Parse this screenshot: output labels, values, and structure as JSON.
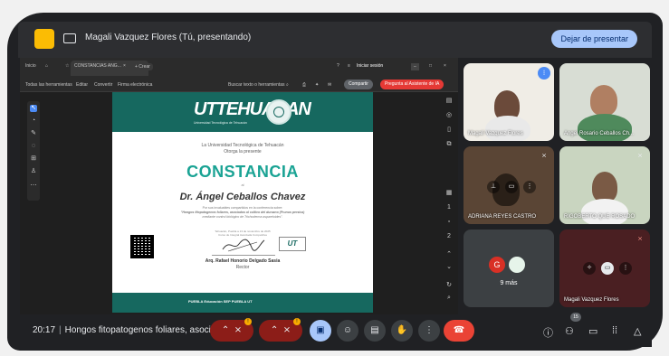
{
  "presenting": {
    "title": "Magali Vazquez Flores (Tú, presentando)",
    "stop_label": "Dejar de presentar"
  },
  "browser": {
    "tab_home": "Inicio",
    "tab_active": "CONSTANCIAS ANG...",
    "tab_new": "+ Crear",
    "sign_in": "Iniciar sesión",
    "menu": [
      "Todas las herramientas",
      "Editar",
      "Convertir",
      "Firma electrónica"
    ],
    "search_tools": "Buscar texto o herramientas",
    "share_label": "Compartir",
    "ai_label": "Pregunta al Asistente de IA"
  },
  "certificate": {
    "logo_text": "UTTEHUACAN",
    "logo_sub": "Universidad Tecnológica de Tehuacán",
    "university": "La Universidad Tecnológica de Tehuacán",
    "grants": "Otorga la presente",
    "heading": "CONSTANCIA",
    "to": "al",
    "recipient": "Dr. Ángel Ceballos Chavez",
    "desc1": "Por sus invaluables compartidos en la conferencia sobre:",
    "desc2": "\"Hongos fitopatogenos foliares, asociados al cultivo del durazno (Prunus persica)",
    "desc3": "mediante control biológico de Trichoderma aspareloides\".",
    "place": "Tehuacán, Puebla a 13 de noviembre de 2025",
    "place2": "Curso de Integral Avanzada Competitiva",
    "signer": "Arq. Rafael Honorio Delgado Sasia",
    "role": "Rector",
    "mini_logo": "UT",
    "footer": "PUEBLA   Educación   SEP   PUEBLA   UT"
  },
  "participants": [
    {
      "name": "Magali Vazquez Flores"
    },
    {
      "name": "Angel Rosario Ceballos Ch..."
    },
    {
      "name": "ADRIANA REYES CASTRO"
    },
    {
      "name": "RIGOBERTO QUE ROSADO"
    },
    {
      "name": "9 más",
      "initial": "G"
    },
    {
      "name": "Magali Vazquez Flores"
    }
  ],
  "controls": {
    "time": "20:17",
    "meeting_title": "Hongos fitopatogenos foliares, asoci...",
    "participant_count": "15"
  },
  "colors": {
    "accent": "#a8c7fa",
    "present_badge": "#fbbc04",
    "doc_green": "#16685f",
    "constancia_teal": "#1aa394",
    "hangup": "#ea4335",
    "muted_red": "#8c1d18"
  },
  "icons": {
    "present": "present-icon",
    "tab_home": "home-icon",
    "tab_star": "star-icon",
    "mic": "mic-off-icon",
    "camera": "camera-off-icon",
    "screen_share": "present-screen-icon",
    "emoji": "emoji-icon",
    "captions": "captions-icon",
    "hand": "raise-hand-icon",
    "more": "more-vert-icon",
    "hangup": "call-end-icon",
    "info": "info-icon",
    "people": "people-icon",
    "chat": "chat-icon",
    "activities": "apps-icon"
  }
}
